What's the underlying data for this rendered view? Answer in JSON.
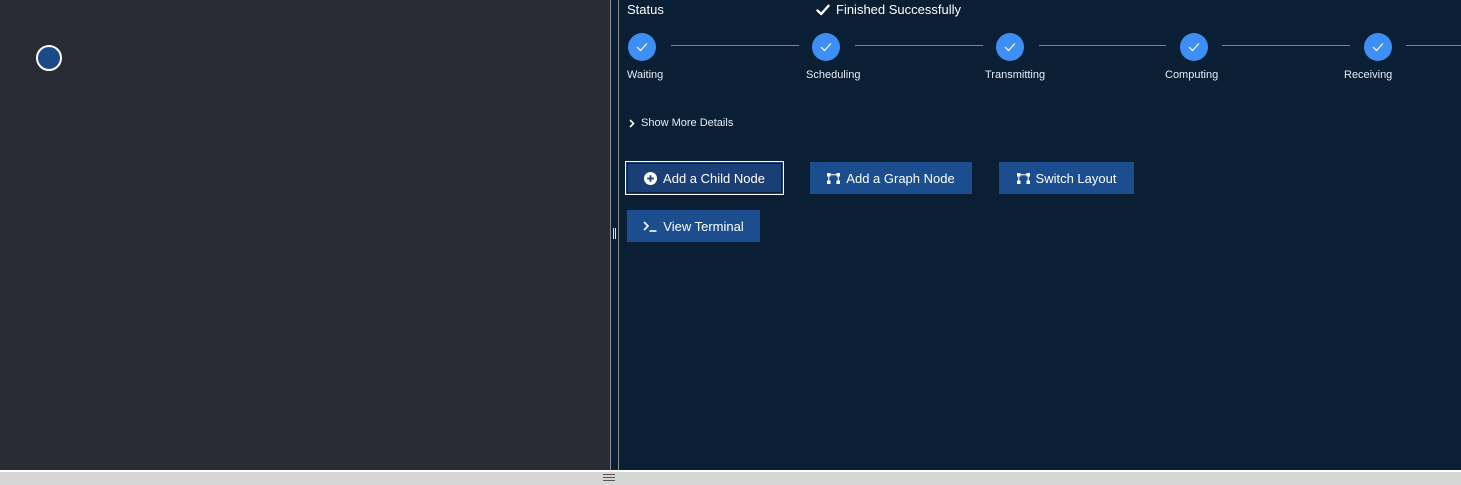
{
  "status": {
    "label": "Status",
    "value": "Finished Successfully",
    "icon": "check-icon"
  },
  "steps": [
    {
      "label": "Waiting",
      "state": "done"
    },
    {
      "label": "Scheduling",
      "state": "done"
    },
    {
      "label": "Transmitting",
      "state": "done"
    },
    {
      "label": "Computing",
      "state": "done"
    },
    {
      "label": "Receiving",
      "state": "done"
    }
  ],
  "details": {
    "toggle_label": "Show More Details",
    "icon": "chevron-right-icon"
  },
  "actions": {
    "add_child_node": "Add a Child Node",
    "add_graph_node": "Add a Graph Node",
    "switch_layout": "Switch Layout",
    "view_terminal": "View Terminal"
  },
  "colors": {
    "graph_background": "#292c35",
    "panel_background": "#0a1f33",
    "accent": "#3d8ef5",
    "button": "#1c4d8f"
  }
}
